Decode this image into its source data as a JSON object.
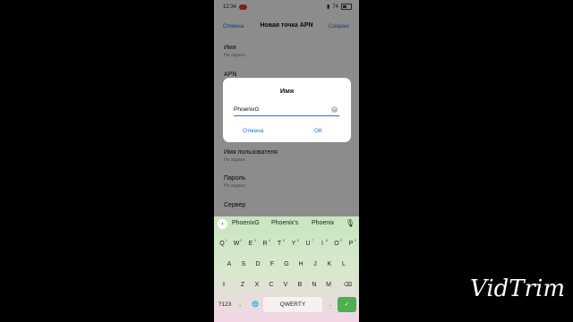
{
  "status": {
    "time": "12:34",
    "battery": "74"
  },
  "header": {
    "cancel": "Отмена",
    "title": "Новая точка APN",
    "save": "Сохран."
  },
  "fields": [
    {
      "label": "Имя",
      "value": "Не задано"
    },
    {
      "label": "APN",
      "value": ""
    },
    {
      "label": "Имя пользователя",
      "value": "Не задано"
    },
    {
      "label": "Пароль",
      "value": "Не задано"
    },
    {
      "label": "Сервер",
      "value": ""
    }
  ],
  "dialog": {
    "title": "Имя",
    "input_value": "PhoenixG",
    "cancel": "Отмена",
    "ok": "OK"
  },
  "keyboard": {
    "suggestions": [
      "PhoenixG",
      "Phoenix's",
      "Phoenix"
    ],
    "row1": [
      {
        "k": "Q",
        "n": "1"
      },
      {
        "k": "W",
        "n": "2"
      },
      {
        "k": "E",
        "n": "3"
      },
      {
        "k": "R",
        "n": "4"
      },
      {
        "k": "T",
        "n": "5"
      },
      {
        "k": "Y",
        "n": "6"
      },
      {
        "k": "U",
        "n": "7"
      },
      {
        "k": "I",
        "n": "8"
      },
      {
        "k": "O",
        "n": "9"
      },
      {
        "k": "P",
        "n": "0"
      }
    ],
    "row2": [
      "A",
      "S",
      "D",
      "F",
      "G",
      "H",
      "J",
      "K",
      "L"
    ],
    "row3": [
      "Z",
      "X",
      "C",
      "V",
      "B",
      "N",
      "M"
    ],
    "sym": "?123",
    "comma": ",",
    "space": "QWERTY",
    "period": "."
  },
  "watermark": "VidTrim"
}
